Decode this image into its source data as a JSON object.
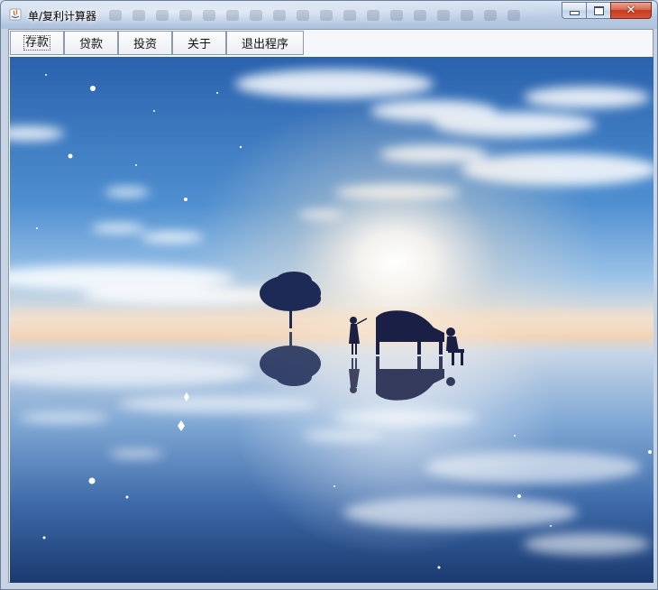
{
  "window": {
    "title": "单/复利计算器"
  },
  "menu": {
    "items": [
      {
        "label": "存款",
        "focused": true
      },
      {
        "label": "贷款",
        "focused": false
      },
      {
        "label": "投资",
        "focused": false
      },
      {
        "label": "关于",
        "focused": false
      },
      {
        "label": "退出程序",
        "focused": false
      }
    ]
  },
  "background_image": {
    "description_icon": "landscape-icon",
    "colors": {
      "sky_top": "#2b6fb8",
      "horizon": "#f3d7b8",
      "sun": "#ffffff",
      "water_bottom": "#1d3f73"
    }
  },
  "caption_buttons": [
    "minimize-icon",
    "maximize-icon",
    "close-icon"
  ]
}
